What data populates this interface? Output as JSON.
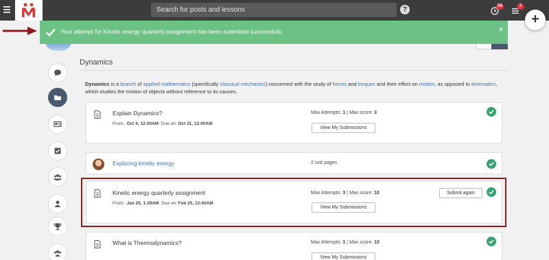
{
  "header": {
    "search_placeholder": "Search for posts and lessons",
    "help_label": "?",
    "notifications_badge": "58",
    "messages_badge": "2",
    "plus_label": "+"
  },
  "toast": {
    "message": "Your attempt for Kinetic energy quarterly assignment has been submitted successfully.",
    "close_label": "×"
  },
  "section": {
    "title": "Dynamics",
    "description": {
      "term": "Dynamics",
      "t1": " is a ",
      "l1": "branch",
      "t2": " of ",
      "l2": "applied mathematics",
      "t3": " (specifically ",
      "l3": "classical mechanics",
      "t4": ") concerned with the study of ",
      "l4": "forces",
      "t5": " and ",
      "l5": "torques",
      "t6": " and their effect on ",
      "l6": "motion",
      "t7": ", as opposed to ",
      "l7": "kinematics",
      "t8": ", which studies the motion of objects without reference to its causes."
    }
  },
  "items": [
    {
      "title": "Explain Dynamics?",
      "from_label": "From::",
      "from": "Oct 4, 12:00AM",
      "due_label": "Due on:",
      "due": "Oct 31, 12:00AM",
      "attempts_label": "Max Attempts:",
      "attempts": "1",
      "sep": "|",
      "score_label": "Max score:",
      "score": "3",
      "view_label": "View My Submissions"
    },
    {
      "title": "Exploring kinetic energy",
      "pages": "2 unit pages"
    },
    {
      "title": "Kinetic energy quarterly assignment",
      "from_label": "From::",
      "from": "Jan 25, 1:29AM",
      "due_label": "Due on:",
      "due": "Feb 25, 12:00AM",
      "attempts_label": "Max Attempts:",
      "attempts": "3",
      "sep": "|",
      "score_label": "Max score:",
      "score": "10",
      "view_label": "View My Submissions",
      "submit_label": "Submit again"
    },
    {
      "title": "What is Thermodynamics?",
      "attempts_label": "Max Attempts:",
      "attempts": "1",
      "sep": "|",
      "score_label": "Max score:",
      "score": "10",
      "view_label": "View My Submissions"
    }
  ],
  "colors": {
    "topbar": "#3c3c3c",
    "toast": "#6cc285",
    "check": "#35a371",
    "highlight": "#8b1c1c",
    "link": "#3b6fb6"
  },
  "icons": {
    "rail": [
      "comment-icon",
      "folder-icon",
      "id-card-icon",
      "checkbox-icon",
      "group-icon",
      "user-icon",
      "trophy-icon",
      "group-icon"
    ]
  }
}
